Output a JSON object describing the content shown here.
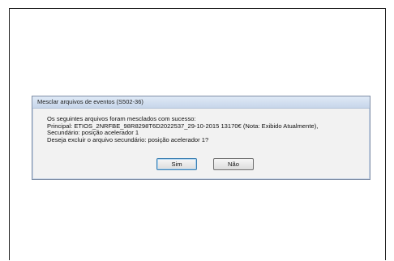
{
  "dialog": {
    "title": "Mesclar arquivos de eventos (S502-36)",
    "lines": [
      "Os seguintes arquivos foram mesclados com sucesso:",
      "Principal: ETIOS_2NRFBE_98R8298T6D2022537_29-10-2015 13170€ (Nota: Exibido Atualmente),",
      "Secundário: posição acelerador 1",
      "Deseja excluir o arquivo secundário: posição acelerador 1?"
    ],
    "buttons": {
      "yes_label": "Sim",
      "no_label": "Não"
    }
  }
}
